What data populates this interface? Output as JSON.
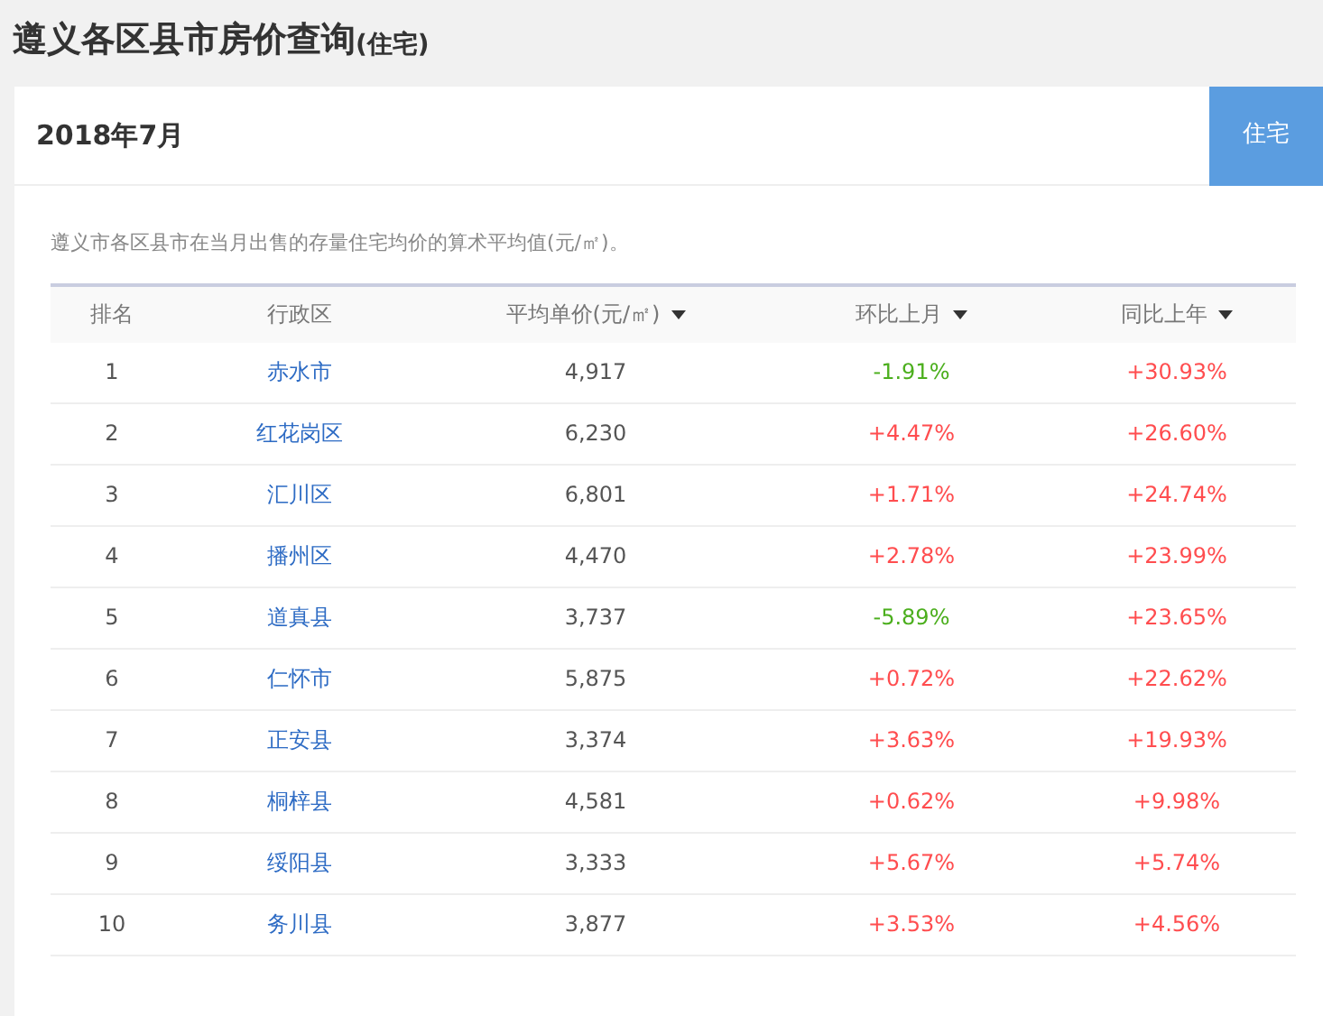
{
  "page_title": {
    "main": "遵义各区县市房价查询",
    "suffix": "(住宅)"
  },
  "period": "2018年7月",
  "type_button": "住宅",
  "description": "遵义市各区县市在当月出售的存量住宅均价的算术平均值(元/㎡)。",
  "table": {
    "columns": [
      {
        "label": "排名",
        "sortable": false
      },
      {
        "label": "行政区",
        "sortable": false
      },
      {
        "label": "平均单价(元/㎡)",
        "sortable": true
      },
      {
        "label": "环比上月",
        "sortable": true
      },
      {
        "label": "同比上年",
        "sortable": true
      }
    ],
    "rows": [
      {
        "rank": "1",
        "district": "赤水市",
        "price": "4,917",
        "mom": {
          "text": "-1.91%",
          "color": "#4caf1e"
        },
        "yoy": {
          "text": "+30.93%",
          "color": "#ff4d4f"
        }
      },
      {
        "rank": "2",
        "district": "红花岗区",
        "price": "6,230",
        "mom": {
          "text": "+4.47%",
          "color": "#ff4d4f"
        },
        "yoy": {
          "text": "+26.60%",
          "color": "#ff4d4f"
        }
      },
      {
        "rank": "3",
        "district": "汇川区",
        "price": "6,801",
        "mom": {
          "text": "+1.71%",
          "color": "#ff4d4f"
        },
        "yoy": {
          "text": "+24.74%",
          "color": "#ff4d4f"
        }
      },
      {
        "rank": "4",
        "district": "播州区",
        "price": "4,470",
        "mom": {
          "text": "+2.78%",
          "color": "#ff4d4f"
        },
        "yoy": {
          "text": "+23.99%",
          "color": "#ff4d4f"
        }
      },
      {
        "rank": "5",
        "district": "道真县",
        "price": "3,737",
        "mom": {
          "text": "-5.89%",
          "color": "#4caf1e"
        },
        "yoy": {
          "text": "+23.65%",
          "color": "#ff4d4f"
        }
      },
      {
        "rank": "6",
        "district": "仁怀市",
        "price": "5,875",
        "mom": {
          "text": "+0.72%",
          "color": "#ff4d4f"
        },
        "yoy": {
          "text": "+22.62%",
          "color": "#ff4d4f"
        }
      },
      {
        "rank": "7",
        "district": "正安县",
        "price": "3,374",
        "mom": {
          "text": "+3.63%",
          "color": "#ff4d4f"
        },
        "yoy": {
          "text": "+19.93%",
          "color": "#ff4d4f"
        }
      },
      {
        "rank": "8",
        "district": "桐梓县",
        "price": "4,581",
        "mom": {
          "text": "+0.62%",
          "color": "#ff4d4f"
        },
        "yoy": {
          "text": "+9.98%",
          "color": "#ff4d4f"
        }
      },
      {
        "rank": "9",
        "district": "绥阳县",
        "price": "3,333",
        "mom": {
          "text": "+5.67%",
          "color": "#ff4d4f"
        },
        "yoy": {
          "text": "+5.74%",
          "color": "#ff4d4f"
        }
      },
      {
        "rank": "10",
        "district": "务川县",
        "price": "3,877",
        "mom": {
          "text": "+3.53%",
          "color": "#ff4d4f"
        },
        "yoy": {
          "text": "+4.56%",
          "color": "#ff4d4f"
        }
      }
    ]
  }
}
